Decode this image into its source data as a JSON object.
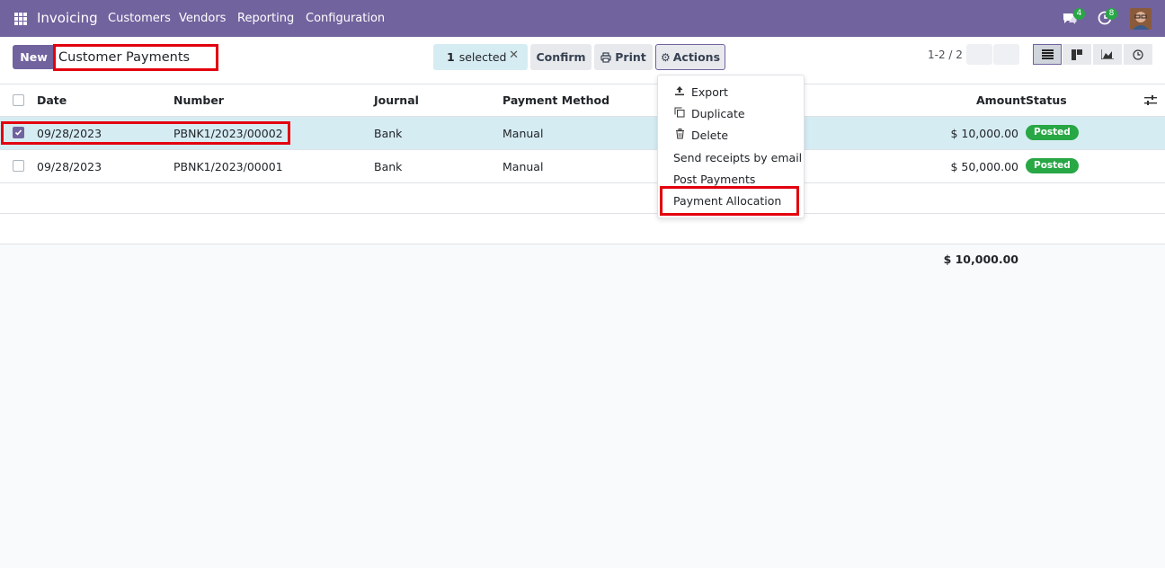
{
  "navbar": {
    "brand": "Invoicing",
    "menu": [
      "Customers",
      "Vendors",
      "Reporting",
      "Configuration"
    ],
    "chat_count": "4",
    "activity_count": "8",
    "colors": {
      "bg": "#71639e",
      "badge": "#28a745"
    }
  },
  "control": {
    "new_label": "New",
    "title": "Customer Payments",
    "selected_count": "1",
    "selected_label": "selected",
    "confirm_label": "Confirm",
    "print_label": "Print",
    "actions_label": "Actions",
    "pager": "1-2 / 2"
  },
  "actions_menu": {
    "items": [
      "Export",
      "Duplicate",
      "Delete",
      "Send receipts by email",
      "Post Payments",
      "Payment Allocation"
    ]
  },
  "table": {
    "columns": [
      "Date",
      "Number",
      "Journal",
      "Payment Method",
      "Amount",
      "Status"
    ],
    "rows": [
      {
        "date": "09/28/2023",
        "number": "PBNK1/2023/00002",
        "journal": "Bank",
        "method": "Manual",
        "amount": "$ 10,000.00",
        "status": "Posted",
        "selected": true
      },
      {
        "date": "09/28/2023",
        "number": "PBNK1/2023/00001",
        "journal": "Bank",
        "method": "Manual",
        "amount": "$ 50,000.00",
        "status": "Posted",
        "selected": false
      }
    ],
    "total": "$ 10,000.00"
  }
}
